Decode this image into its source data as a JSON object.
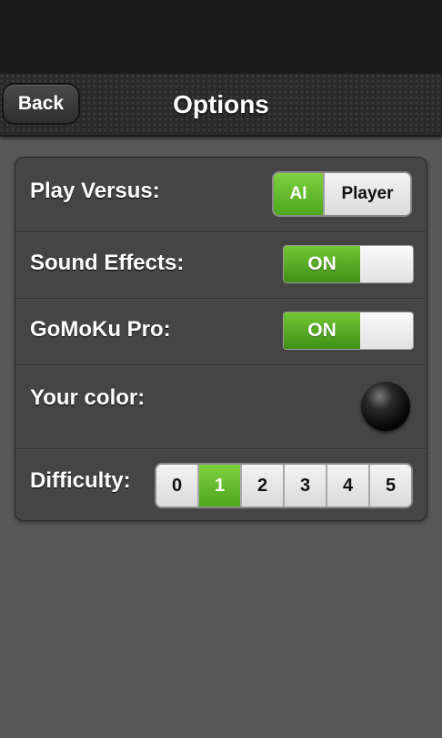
{
  "header": {
    "back_label": "Back",
    "title": "Options"
  },
  "options": {
    "play_versus": {
      "label": "Play Versus:",
      "choices": [
        "AI",
        "Player"
      ],
      "selected": "AI"
    },
    "sound_effects": {
      "label": "Sound Effects:",
      "state": "ON"
    },
    "gomoku_pro": {
      "label": "GoMoKu Pro:",
      "state": "ON"
    },
    "your_color": {
      "label": "Your color:",
      "stone_color": "black"
    },
    "difficulty": {
      "label": "Difficulty:",
      "levels": [
        "0",
        "1",
        "2",
        "3",
        "4",
        "5"
      ],
      "selected": "1"
    }
  },
  "colors": {
    "accent_green": "#5cb82a",
    "background": "#585858",
    "panel": "#454545",
    "header": "#2a2a2a"
  }
}
